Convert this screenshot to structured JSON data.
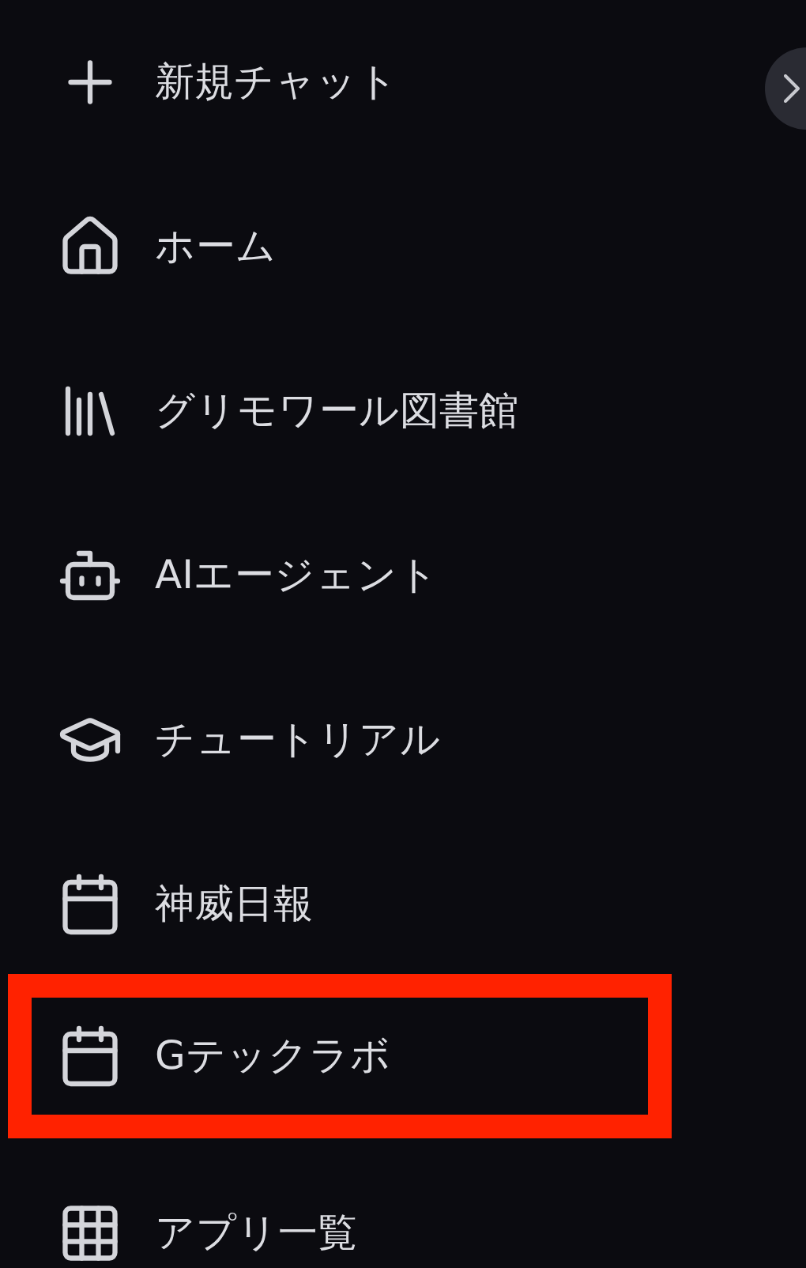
{
  "items": [
    {
      "kind": "plus",
      "label": "新規チャット",
      "highlighted": false
    },
    {
      "kind": "home",
      "label": "ホーム",
      "highlighted": false
    },
    {
      "kind": "library",
      "label": "グリモワール図書館",
      "highlighted": false
    },
    {
      "kind": "bot",
      "label": "AIエージェント",
      "highlighted": false
    },
    {
      "kind": "graduation",
      "label": "チュートリアル",
      "highlighted": false
    },
    {
      "kind": "calendar",
      "label": "神威日報",
      "highlighted": false
    },
    {
      "kind": "calendar",
      "label": "Gテックラボ",
      "highlighted": true
    },
    {
      "kind": "grid",
      "label": "アプリ一覧",
      "highlighted": false
    }
  ]
}
